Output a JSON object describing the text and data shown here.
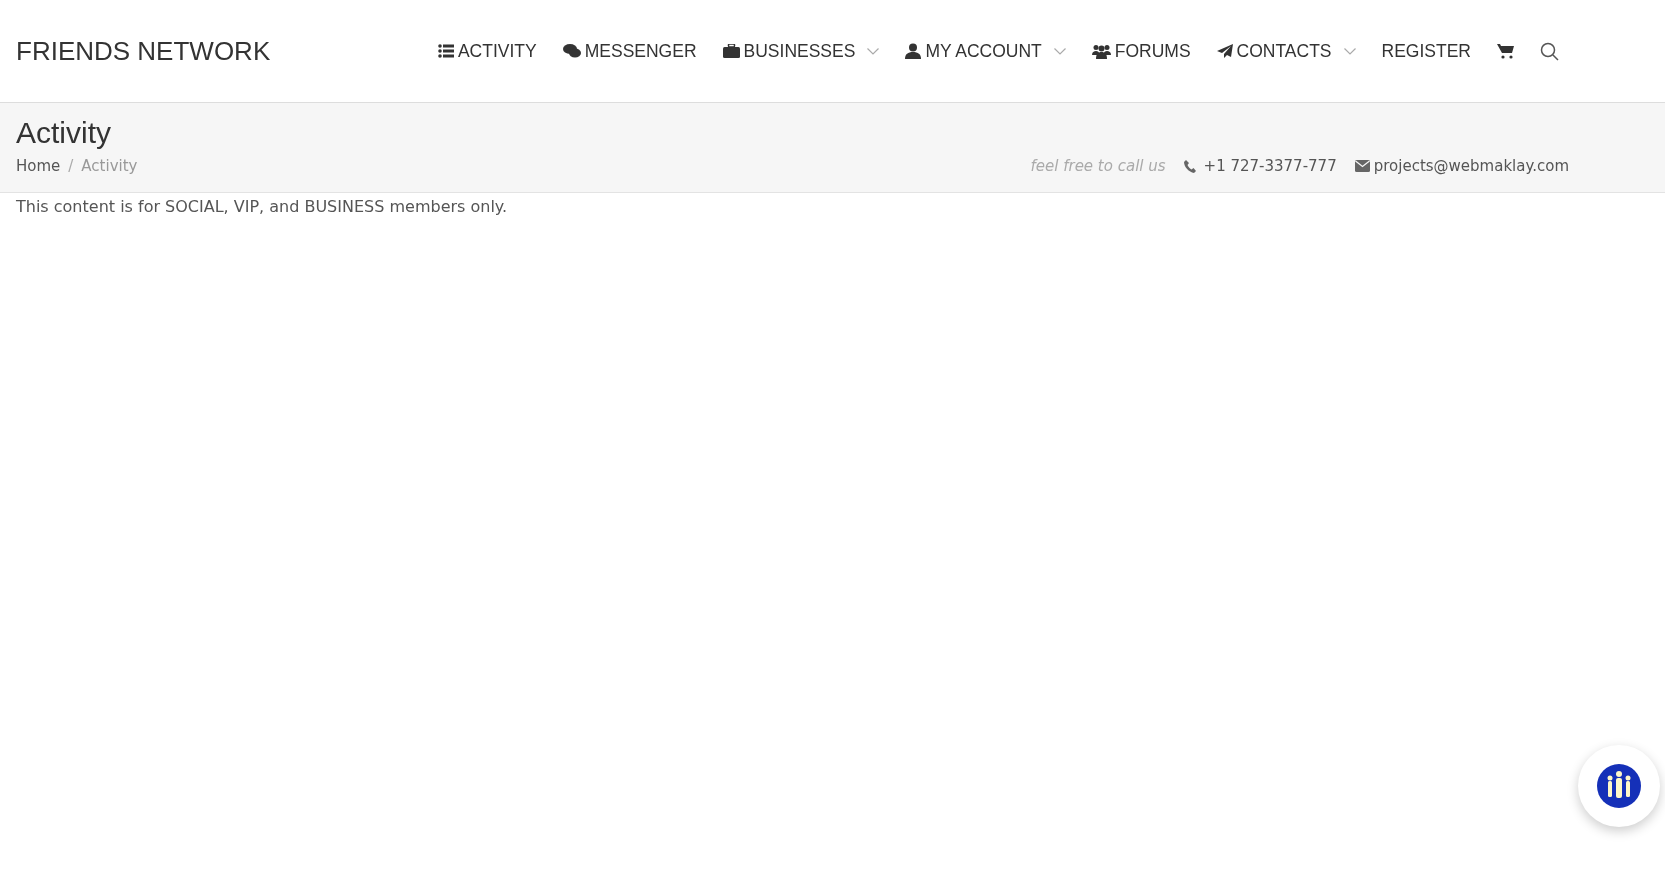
{
  "brand": "FRIENDS NETWORK",
  "nav": [
    {
      "label": "ACTIVITY",
      "dropdown": false
    },
    {
      "label": "MESSENGER",
      "dropdown": false
    },
    {
      "label": "BUSINESSES",
      "dropdown": true
    },
    {
      "label": "MY ACCOUNT",
      "dropdown": true
    },
    {
      "label": "FORUMS",
      "dropdown": false
    },
    {
      "label": "CONTACTS",
      "dropdown": true
    },
    {
      "label": "REGISTER",
      "dropdown": false
    }
  ],
  "page_title": "Activity",
  "breadcrumb_separator": "/",
  "breadcrumb": [
    {
      "label": "Home",
      "current": false
    },
    {
      "label": "Activity",
      "current": true
    }
  ],
  "contact": {
    "tagline": "feel free to call us",
    "phone": "+1 727-3377-777",
    "email": "projects@webmaklay.com"
  },
  "notice": "This content is for SOCIAL, VIP, and BUSINESS members only."
}
